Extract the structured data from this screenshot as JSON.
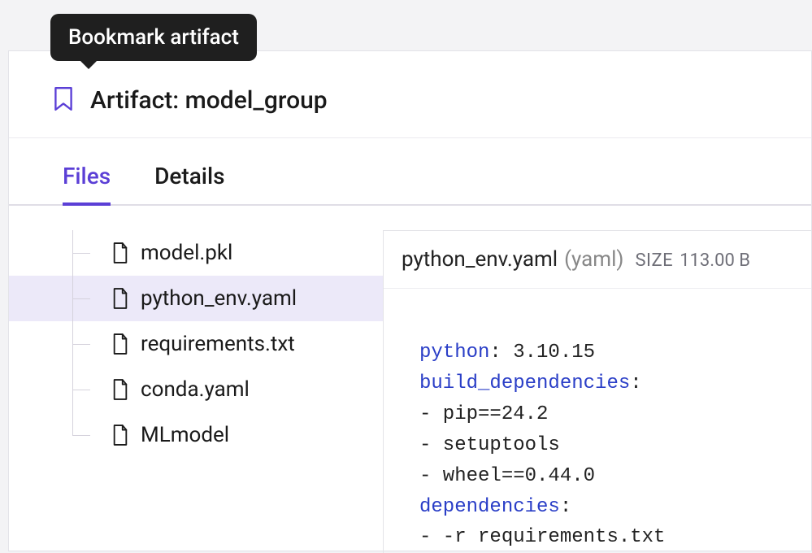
{
  "tooltip": {
    "text": "Bookmark artifact"
  },
  "header": {
    "title": "Artifact: model_group"
  },
  "tabs": [
    {
      "id": "files",
      "label": "Files",
      "active": true
    },
    {
      "id": "details",
      "label": "Details",
      "active": false
    }
  ],
  "files": [
    {
      "name": "model.pkl",
      "selected": false
    },
    {
      "name": "python_env.yaml",
      "selected": true
    },
    {
      "name": "requirements.txt",
      "selected": false
    },
    {
      "name": "conda.yaml",
      "selected": false
    },
    {
      "name": "MLmodel",
      "selected": false
    }
  ],
  "viewer": {
    "filename": "python_env.yaml",
    "filetype": "(yaml)",
    "size_label": "SIZE",
    "size_value": "113.00 B"
  },
  "code_lines": [
    {
      "type": "kv",
      "key": "python",
      "rest": ": 3.10.15"
    },
    {
      "type": "kv",
      "key": "build_dependencies",
      "rest": ":"
    },
    {
      "type": "item",
      "text": "- pip==24.2"
    },
    {
      "type": "item",
      "text": "- setuptools"
    },
    {
      "type": "item",
      "text": "- wheel==0.44.0"
    },
    {
      "type": "kv",
      "key": "dependencies",
      "rest": ":"
    },
    {
      "type": "item",
      "text": "- -r requirements.txt"
    }
  ]
}
